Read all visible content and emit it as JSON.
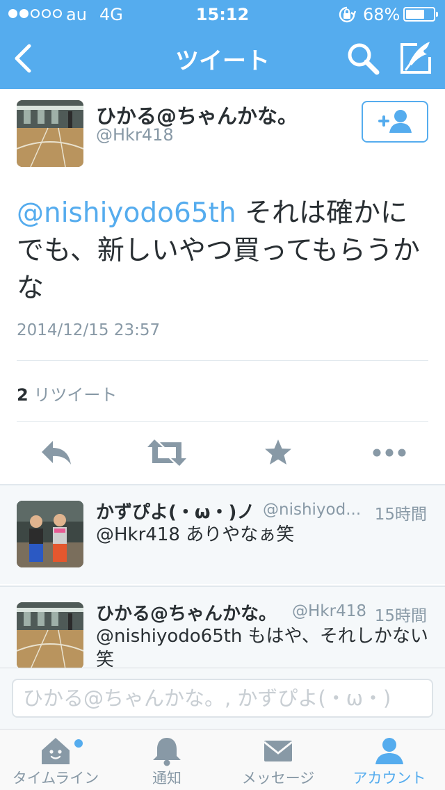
{
  "status_bar": {
    "carrier": "au",
    "network": "4G",
    "time": "15:12",
    "battery_percent": "68%",
    "battery_level": 0.68,
    "signal_bars_filled": 2,
    "signal_bars_total": 5
  },
  "nav": {
    "title": "ツイート"
  },
  "tweet": {
    "author_name": "ひかる@ちゃんかな。",
    "author_handle": "@Hkr418",
    "mention": "@nishiyodo65th",
    "text": " それは確かに でも、新しいやつ買ってもらうかな",
    "timestamp": "2014/12/15 23:57",
    "retweet_count": "2",
    "retweet_label": "リツイート"
  },
  "replies": [
    {
      "name": "かずぴよ(・ω・)ノ",
      "handle": "@nishiyod...",
      "time": "15時間",
      "text": "@Hkr418 ありやなぁ笑"
    },
    {
      "name": "ひかる@ちゃんかな。",
      "handle": "@Hkr418",
      "time": "15時間",
      "text": "@nishiyodo65th もはや、それしかない笑"
    }
  ],
  "composer": {
    "value": "ひかる@ちゃんかな。, かずぴよ(・ω・)"
  },
  "tabs": [
    {
      "label": "タイムライン"
    },
    {
      "label": "通知"
    },
    {
      "label": "メッセージ"
    },
    {
      "label": "アカウント"
    }
  ],
  "colors": {
    "accent": "#55acee",
    "text": "#292f33",
    "secondary_text": "#8899a6",
    "divider": "#e1e8ed",
    "reply_background": "#f5f8fa"
  },
  "icons": {
    "back": "chevron-left-icon",
    "search": "search-icon",
    "compose": "compose-icon",
    "follow": "add-user-icon",
    "reply": "reply-icon",
    "retweet": "retweet-icon",
    "favorite": "star-icon",
    "more": "more-icon",
    "timeline": "home-icon",
    "notifications": "bell-icon",
    "messages": "envelope-icon",
    "account": "person-icon"
  }
}
